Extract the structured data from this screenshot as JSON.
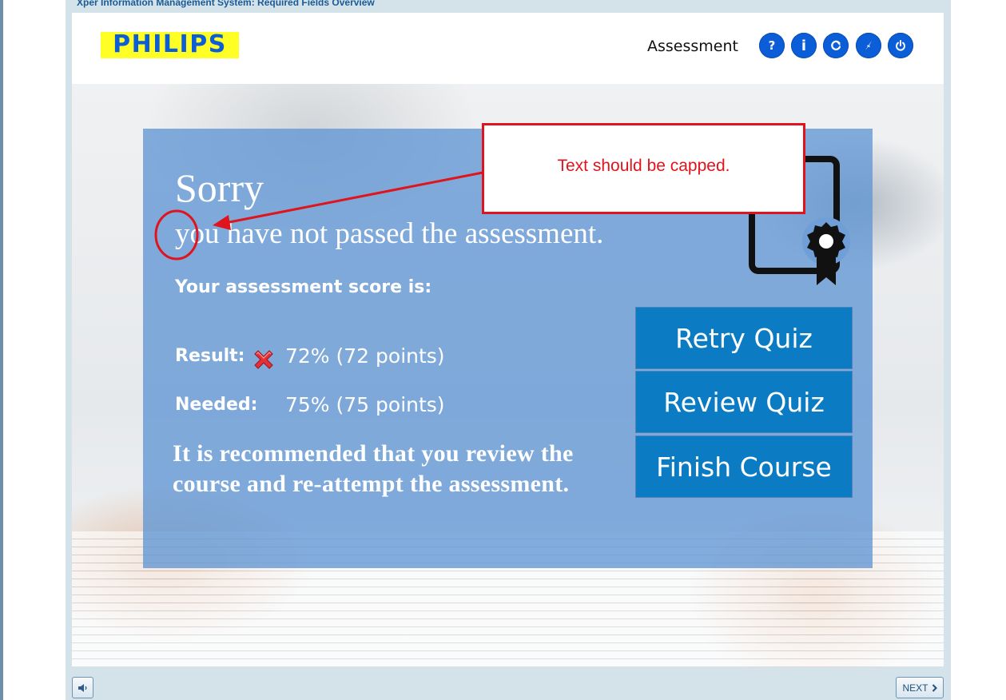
{
  "window": {
    "title": "Xper Information Management System: Required Fields Overview"
  },
  "header": {
    "logo_text": "PHILIPS",
    "title": "Assessment",
    "buttons": [
      {
        "icon": "help-icon",
        "glyph": "?"
      },
      {
        "icon": "info-icon",
        "glyph": "i"
      },
      {
        "icon": "refresh-icon"
      },
      {
        "icon": "compass-icon"
      },
      {
        "icon": "power-icon"
      }
    ]
  },
  "result_panel": {
    "heading": "Sorry",
    "subheading": "you have not passed the assessment.",
    "score_heading": "Your assessment score is:",
    "result_label": "Result:",
    "result_value": "72% (72 points)",
    "result_status_icon": "fail-x-icon",
    "needed_label": "Needed:",
    "needed_value": "75% (75 points)",
    "recommendation": "It is recommended that you review the course and re-attempt the assessment."
  },
  "actions": {
    "retry": "Retry Quiz",
    "review": "Review Quiz",
    "finish": "Finish Course"
  },
  "annotation": {
    "callout_text": "Text should be capped.",
    "color": "#e0141c"
  },
  "footer": {
    "audio_icon": "speaker-icon",
    "next_label": "NEXT"
  },
  "colors": {
    "brand_blue": "#0b5ed7",
    "logo_yellow": "#ffff26",
    "button_blue": "#0b7cc4",
    "panel_blue": "#6096d4"
  }
}
